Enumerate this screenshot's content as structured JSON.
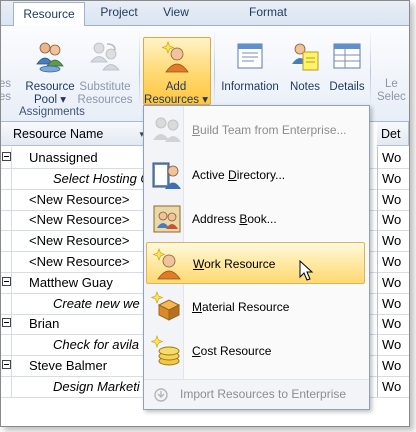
{
  "tabs": [
    {
      "label": "Resource",
      "active": true
    },
    {
      "label": "Project"
    },
    {
      "label": "View"
    },
    {
      "label": "Format",
      "context": true
    }
  ],
  "ribbon": {
    "left_partial": [
      "ces",
      "es"
    ],
    "resource_pool": [
      "Resource",
      "Pool ▾"
    ],
    "substitute": [
      "Substitute",
      "Resources"
    ],
    "add_resources": [
      "Add",
      "Resources ▾"
    ],
    "information": "Information",
    "notes": "Notes",
    "details": "Details",
    "right_partial": [
      "Le",
      "Selec"
    ],
    "group_label": "Assignments"
  },
  "grid": {
    "header_name": "Resource Name",
    "header_details": "Det",
    "rows": [
      {
        "name": "Unassigned",
        "italic": false,
        "expander": true,
        "det": "Wo"
      },
      {
        "name": "Select Hosting C",
        "italic": true,
        "expander": false,
        "det": "Wo"
      },
      {
        "name": "<New Resource>",
        "italic": false,
        "expander": false,
        "det": "Wo"
      },
      {
        "name": "<New Resource>",
        "italic": false,
        "expander": false,
        "det": "Wo"
      },
      {
        "name": "<New Resource>",
        "italic": false,
        "expander": false,
        "det": "Wo"
      },
      {
        "name": "<New Resource>",
        "italic": false,
        "expander": false,
        "det": "Wo"
      },
      {
        "name": "Matthew Guay",
        "italic": false,
        "expander": true,
        "det": "Wo"
      },
      {
        "name": "Create new we",
        "italic": true,
        "expander": false,
        "det": "Wo"
      },
      {
        "name": "Brian",
        "italic": false,
        "expander": true,
        "det": "Wo"
      },
      {
        "name": "Check for avila",
        "italic": true,
        "expander": false,
        "det": "Wo"
      },
      {
        "name": "Steve Balmer",
        "italic": false,
        "expander": true,
        "det": "Wo"
      },
      {
        "name": "Design Marketi",
        "italic": true,
        "expander": false,
        "det": "Wo"
      }
    ]
  },
  "menu": {
    "items": [
      {
        "pre": "",
        "u": "B",
        "post": "uild Team from Enterprise...",
        "disabled": true,
        "icon": "build-team-icon"
      },
      {
        "pre": "Active ",
        "u": "D",
        "post": "irectory...",
        "disabled": false,
        "icon": "active-directory-icon"
      },
      {
        "pre": "Address ",
        "u": "B",
        "post": "ook...",
        "disabled": false,
        "icon": "address-book-icon"
      },
      {
        "pre": "",
        "u": "W",
        "post": "ork Resource",
        "disabled": false,
        "icon": "work-resource-icon",
        "hover": true
      },
      {
        "pre": "",
        "u": "M",
        "post": "aterial Resource",
        "disabled": false,
        "icon": "material-resource-icon"
      },
      {
        "pre": "",
        "u": "C",
        "post": "ost Resource",
        "disabled": false,
        "icon": "cost-resource-icon"
      }
    ],
    "footer": "Import Resources to Enterprise"
  },
  "colors": {
    "accent_hover": "#ffd970",
    "ribbon_bg": "#e8eef7",
    "tab_text": "#1e395b"
  }
}
